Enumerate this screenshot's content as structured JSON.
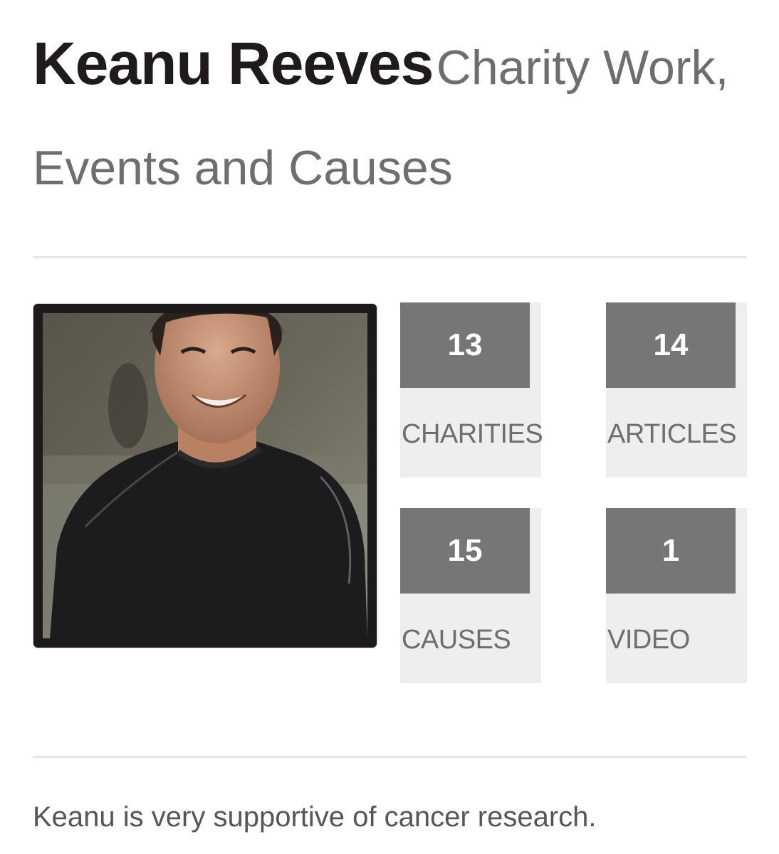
{
  "header": {
    "name": "Keanu Reeves",
    "subtitle": "Charity Work, Events and Causes"
  },
  "profile_photo": {
    "alt": "Keanu Reeves"
  },
  "stats": {
    "charities": {
      "count": "13",
      "label": "CHARITIES"
    },
    "articles": {
      "count": "14",
      "label": "ARTICLES"
    },
    "causes": {
      "count": "15",
      "label": "CAUSES"
    },
    "video": {
      "count": "1",
      "label": "VIDEO"
    }
  },
  "description": "Keanu is very supportive of cancer research.",
  "colors": {
    "tile_background": "#eeeeee",
    "count_box": "#767676",
    "title_text": "#1f1a1c",
    "subtitle_text": "#6e6e6e",
    "photo_border": "#1e1a1b"
  }
}
